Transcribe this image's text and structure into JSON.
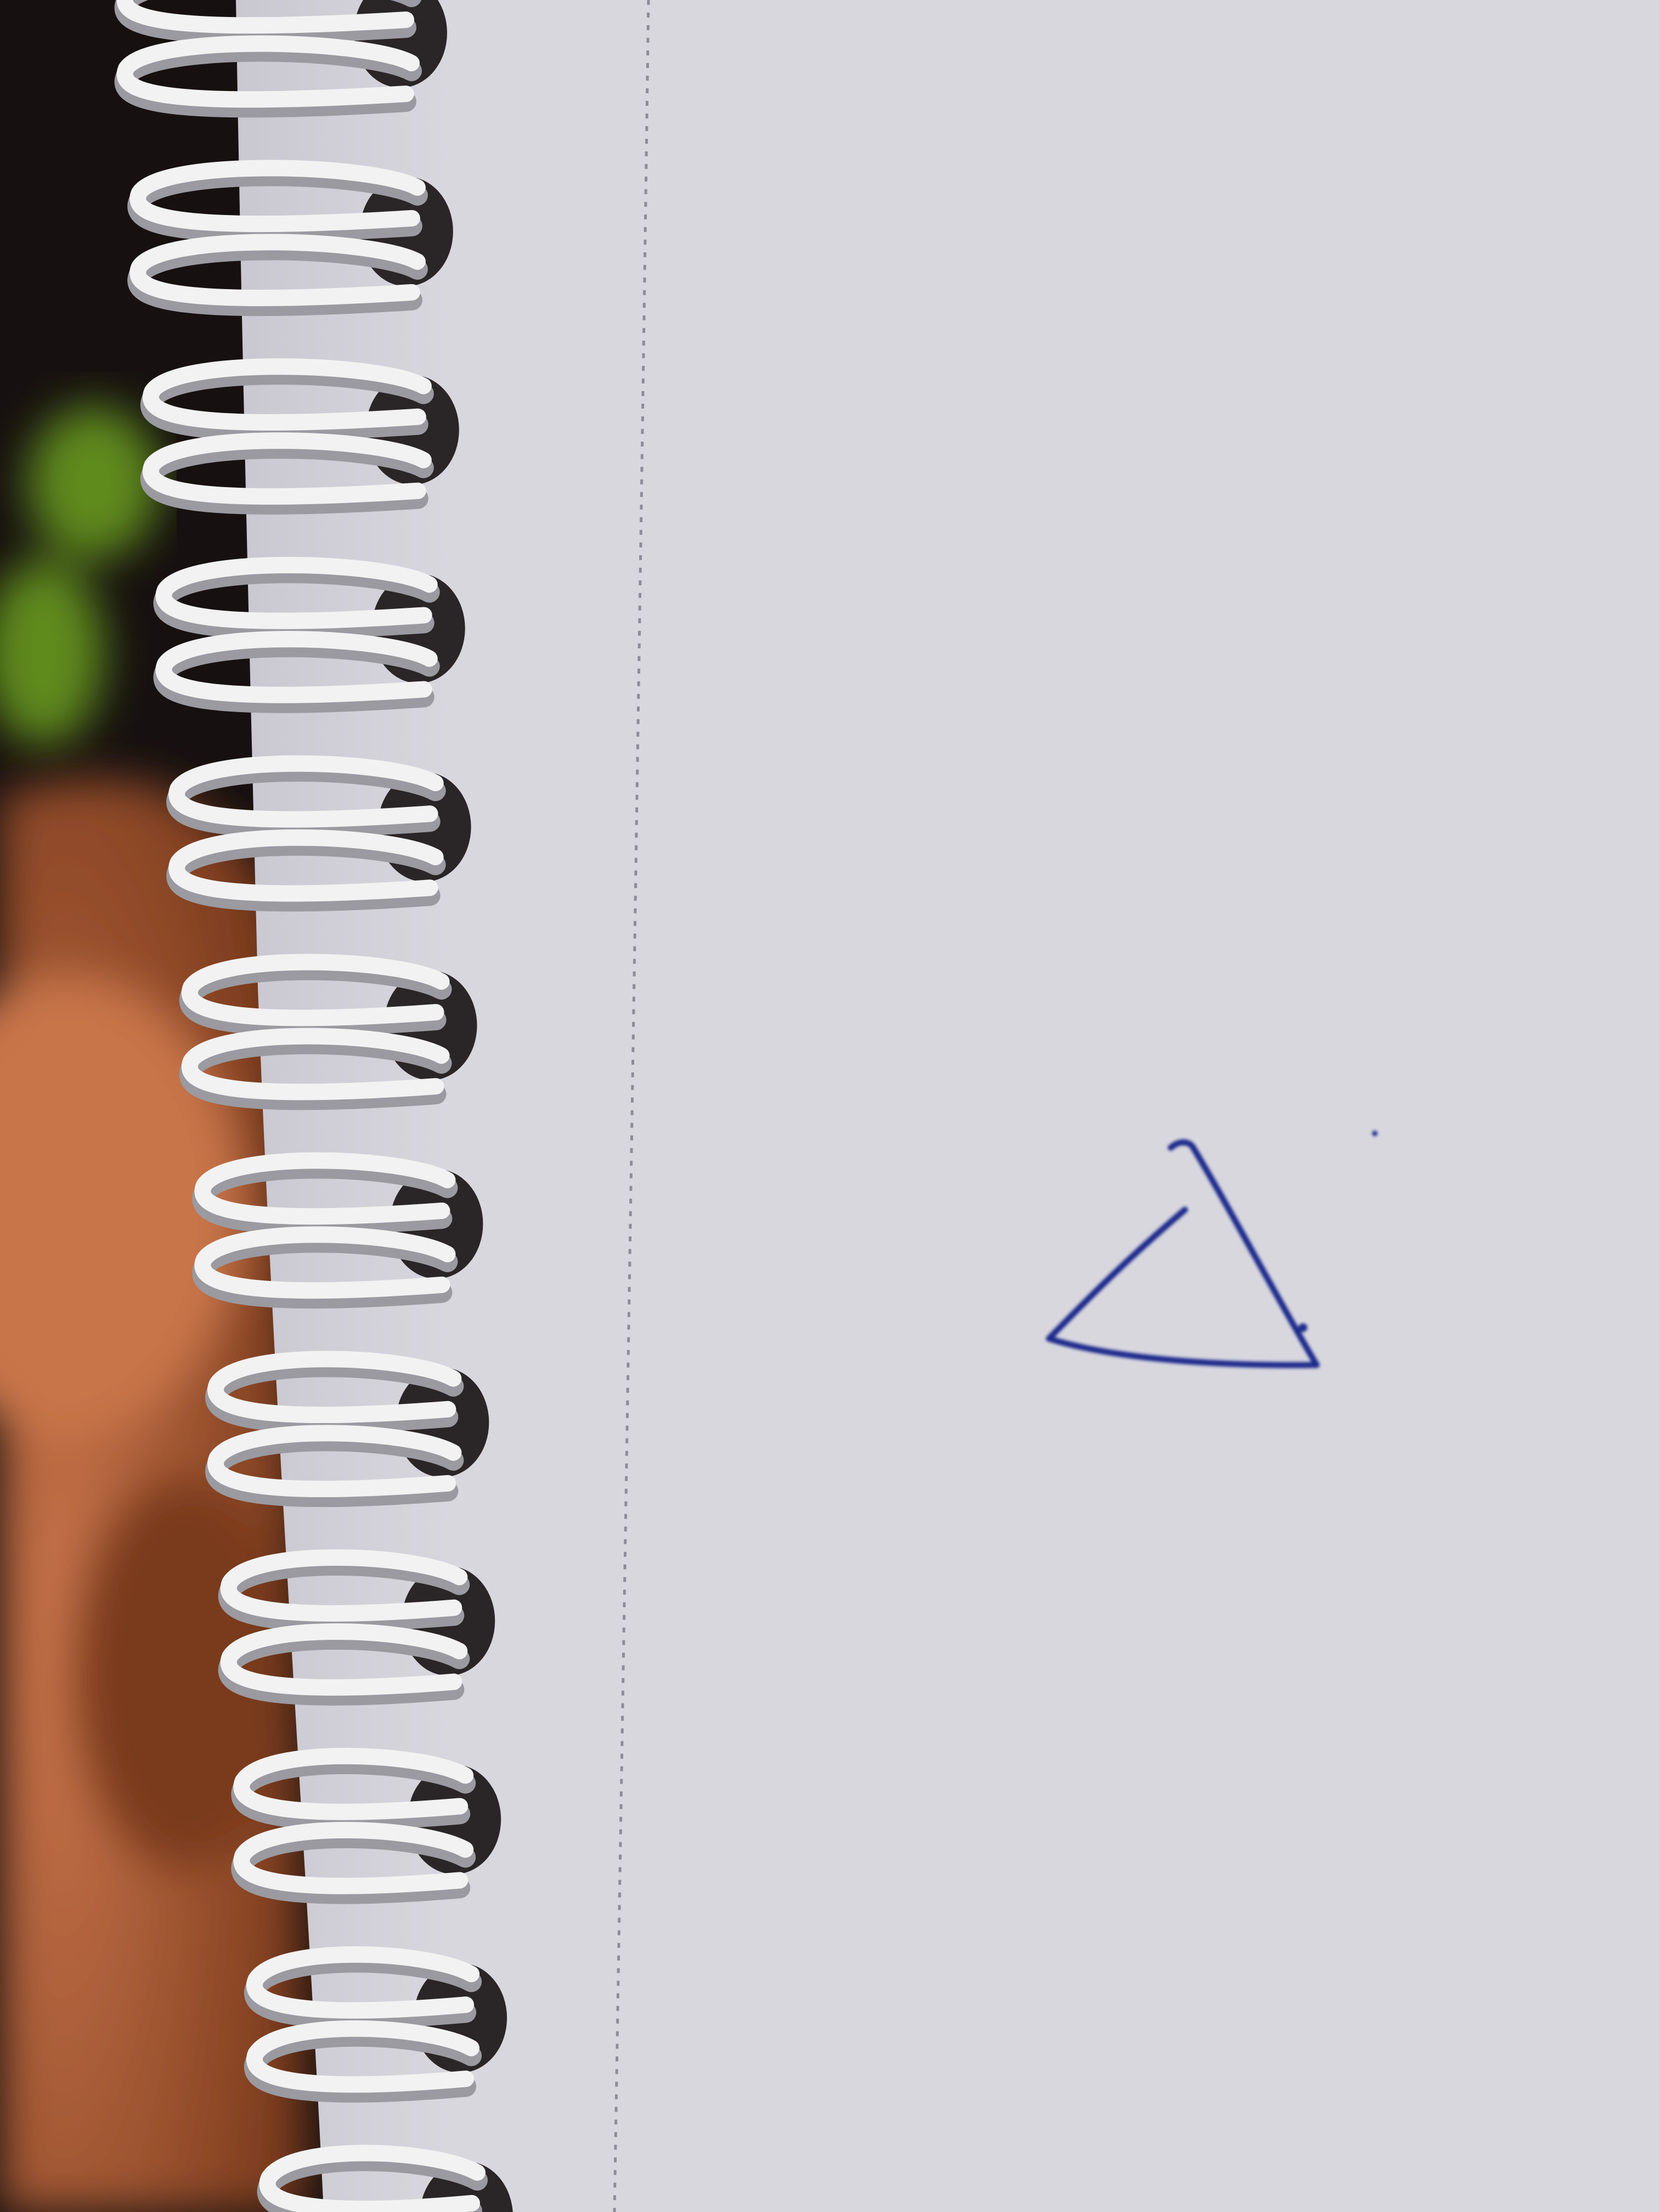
{
  "scene": {
    "subject": "spiral-notebook-page",
    "background_colors": {
      "dark": "#161010",
      "leaf_green": "#5e8a1e",
      "hand_skin": "#c8744a",
      "hand_shadow": "#7a3a1c"
    },
    "paper_color": "#d9d7de",
    "paper_shade_color": "#c9c7cf",
    "margin_line_color": "#8e8c96",
    "spiral_wire_color": "#f2f2f2",
    "spiral_wire_shadow": "#9a9aa0",
    "binding_hole_color": "#2a2526",
    "ink_color": "#1f2a8c",
    "spiral_loop_count": 12,
    "drawing": {
      "shape": "triangle",
      "stroke": "hand-drawn",
      "ink": "blue"
    }
  }
}
